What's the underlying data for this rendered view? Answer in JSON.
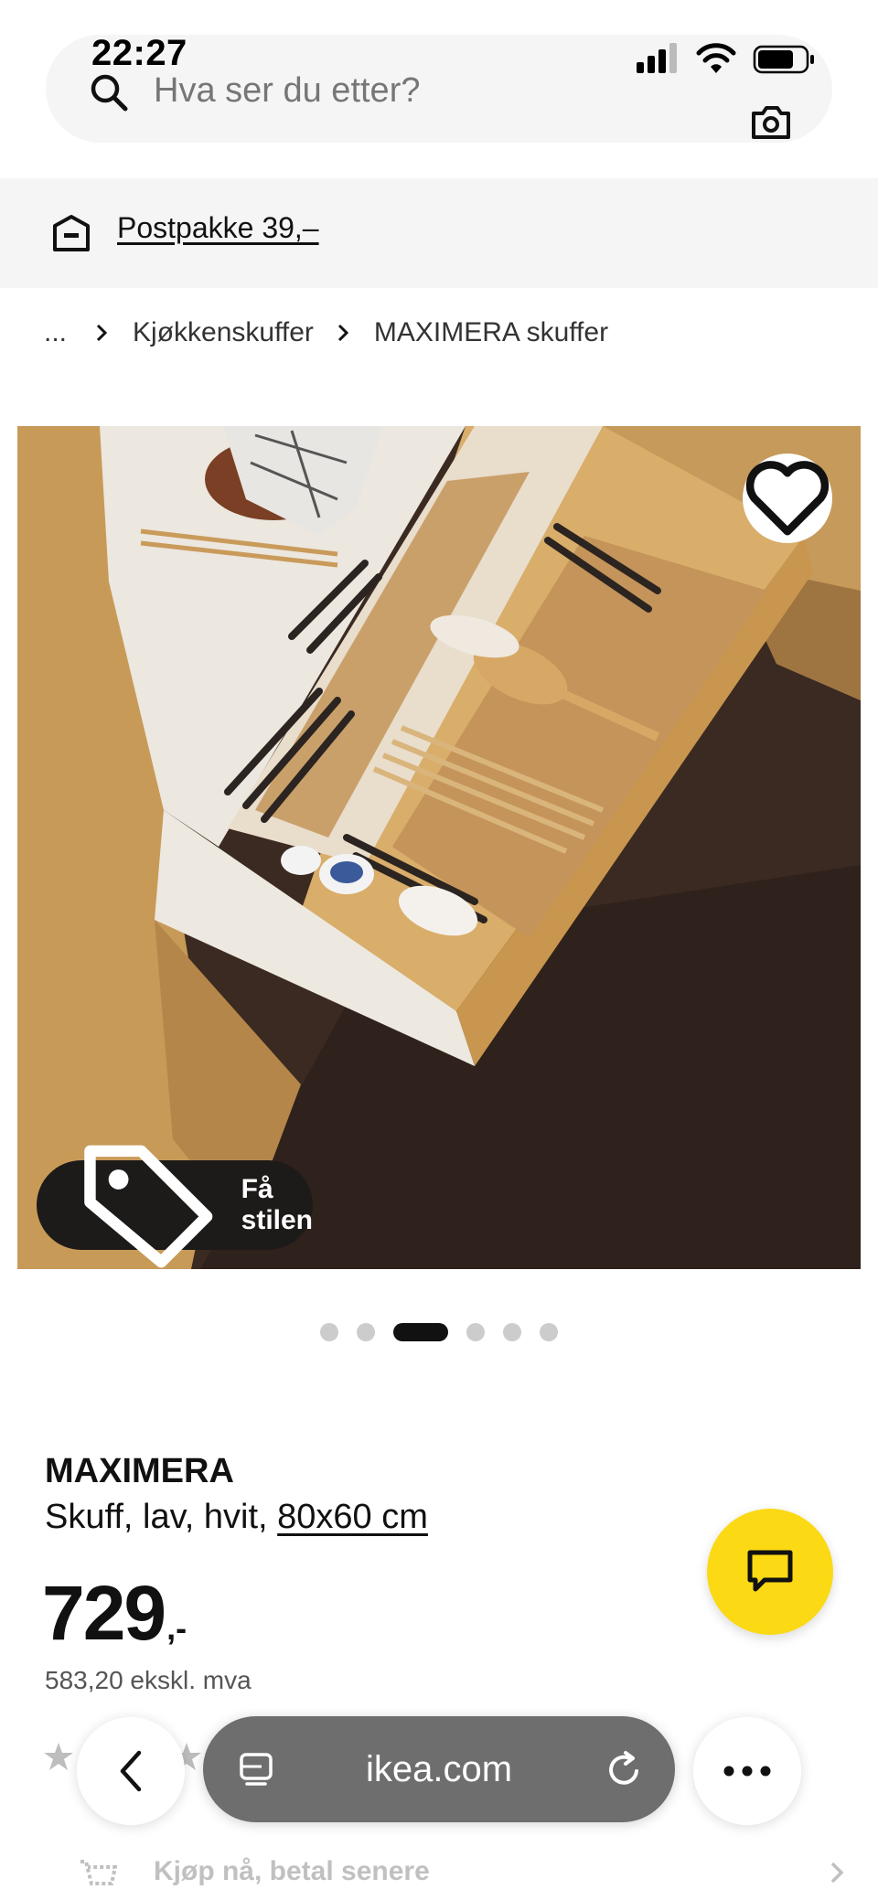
{
  "status_bar": {
    "time": "22:27",
    "icons": [
      "signal-icon",
      "wifi-icon",
      "battery-icon"
    ]
  },
  "search": {
    "placeholder": "Hva ser du etter?",
    "icons": [
      "search-icon",
      "camera-icon"
    ]
  },
  "shipping_banner": {
    "text": "Postpakke 39,–",
    "icon": "package-icon"
  },
  "breadcrumb": {
    "items": [
      "...",
      "Kjøkkenskuffer",
      "MAXIMERA skuffer"
    ]
  },
  "product_image": {
    "favorite_icon": "heart-icon",
    "style_button_label": "Få stilen",
    "style_button_icon": "tag-icon",
    "carousel": {
      "total": 6,
      "active_index": 2
    }
  },
  "product": {
    "name": "MAXIMERA",
    "description": "Skuff, lav, hvit,",
    "size": "80x60 cm",
    "price_main": "729",
    "price_suffix": ",-",
    "price_excl_vat": "583,20 ekskl. mva"
  },
  "chat": {
    "icon": "chat-icon"
  },
  "payment": {
    "text": "Kjøp nå, betal senere"
  },
  "browser_toolbar": {
    "url": "ikea.com",
    "icons": [
      "back-icon",
      "tabs-icon",
      "reload-icon",
      "more-icon"
    ]
  },
  "colors": {
    "chat_yellow": "#fbd914",
    "banner_bg": "#f5f5f5",
    "url_pill_bg": "#6e6e6e"
  }
}
